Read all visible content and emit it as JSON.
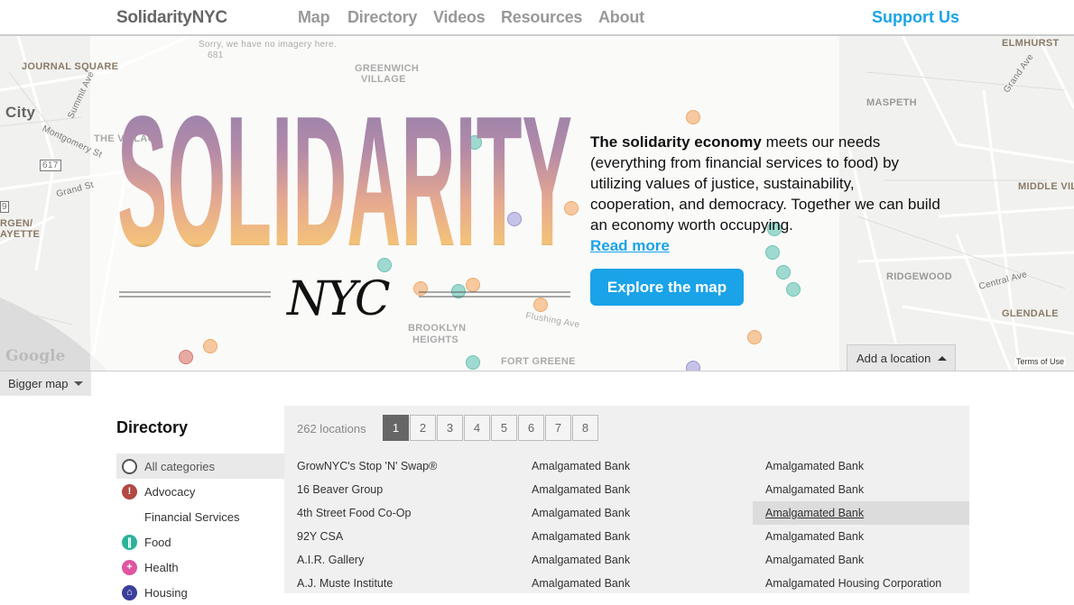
{
  "nav": {
    "brand": "SolidarityNYC",
    "links": [
      "Map",
      "Directory",
      "Videos",
      "Resources",
      "About"
    ],
    "support": "Support Us"
  },
  "map": {
    "labels": {
      "journal_square": "JOURNAL SQUARE",
      "city": "City",
      "the_village": "THE VILLAGE",
      "bergen": "RGEN/",
      "lafayette": "AYETTE",
      "greenwich": "GREENWICH",
      "village": "VILLAGE",
      "no_imagery": "Sorry, we have no imagery here.",
      "elmhurst": "ELMHURST",
      "maspeth": "MASPETH",
      "middle_village": "MIDDLE VILL",
      "ridgewood": "RIDGEWOOD",
      "glendale": "GLENDALE",
      "brooklyn_heights": "BROOKLYN",
      "heights": "HEIGHTS",
      "fort_greene": "FORT GREENE",
      "summit_ave": "Summit Ave",
      "montgomery": "Montgomery St",
      "grand_st": "Grand St",
      "grand_ave": "Grand Ave",
      "central_ave": "Central Ave",
      "flushing_ave": "Flushing Ave",
      "route_617": "617",
      "route_681": "681",
      "route_9": "9"
    },
    "google": "Google",
    "terms": "Terms of Use",
    "add_location": "Add a location",
    "bigger_map": "Bigger map"
  },
  "hero": {
    "logo_word": "SOLIDARITY",
    "logo_sub": "NYC",
    "intro_bold": "The solidarity economy",
    "intro_rest": " meets our needs (everything from financial services to food) by utilizing values of justice, sustainability, cooperation, and democracy. Together we can build an economy worth occupying.",
    "read_more": "Read more",
    "explore": "Explore the map"
  },
  "directory": {
    "title": "Directory",
    "categories": [
      {
        "label": "All categories",
        "icon": "circle-outline-icon",
        "color": "#ffffff"
      },
      {
        "label": "Advocacy",
        "icon": "exclamation-icon",
        "color": "#b04a42"
      },
      {
        "label": "Financial Services",
        "icon": "",
        "color": ""
      },
      {
        "label": "Food",
        "icon": "fork-knife-icon",
        "color": "#2bb39a"
      },
      {
        "label": "Health",
        "icon": "plus-icon",
        "color": "#e055a0"
      },
      {
        "label": "Housing",
        "icon": "house-icon",
        "color": "#3b3f9a"
      }
    ],
    "count": "262 locations",
    "pages": [
      "1",
      "2",
      "3",
      "4",
      "5",
      "6",
      "7",
      "8"
    ],
    "columns": [
      [
        "GrowNYC's Stop 'N' Swap®",
        "16 Beaver Group",
        "4th Street Food Co-Op",
        "92Y CSA",
        "A.I.R. Gallery",
        "A.J. Muste Institute"
      ],
      [
        "Amalgamated Bank",
        "Amalgamated Bank",
        "Amalgamated Bank",
        "Amalgamated Bank",
        "Amalgamated Bank",
        "Amalgamated Bank"
      ],
      [
        "Amalgamated Bank",
        "Amalgamated Bank",
        "Amalgamated Bank",
        "Amalgamated Bank",
        "Amalgamated Bank",
        "Amalgamated Housing Corporation"
      ]
    ]
  },
  "colors": {
    "accent": "#1aa3e8",
    "nav_gray": "#999999"
  }
}
